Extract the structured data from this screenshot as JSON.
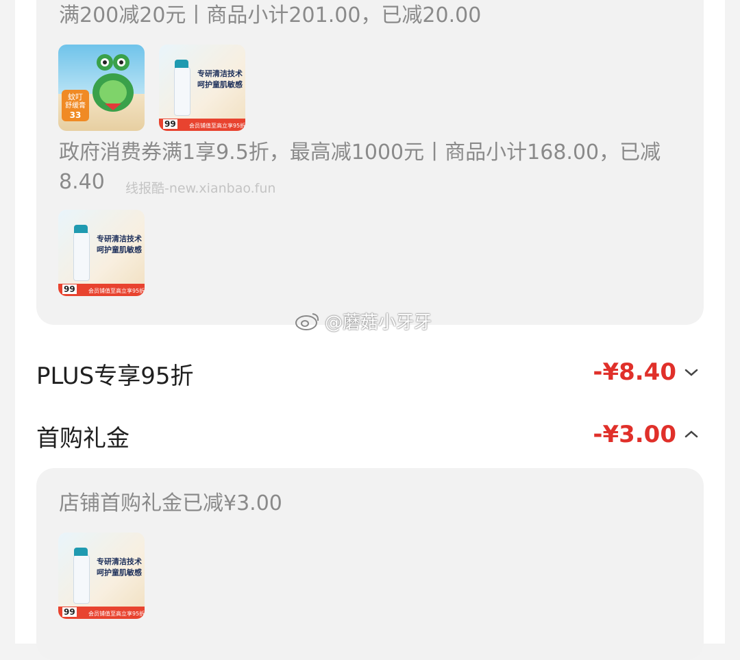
{
  "discount_groups": [
    {
      "description": "满200减20元丨商品小计201.00，已减20.00",
      "products": [
        {
          "image_desc": "frog-cream-product",
          "badge_line1": "蚊叮",
          "badge_line2": "舒缓膏",
          "price": "33"
        },
        {
          "image_desc": "aveeno-kids-wash",
          "headline_1": "专研清洁技术",
          "headline_2": "呵护童肌敏感",
          "price": "99",
          "banner": "会员铺值至高立享95折"
        }
      ]
    },
    {
      "description_line1": "政府消费券满1享9.5折，最高减1000元丨商品小计168.00，已减",
      "description_line2": "8.40",
      "products": [
        {
          "image_desc": "aveeno-kids-wash",
          "headline_1": "专研清洁技术",
          "headline_2": "呵护童肌敏感",
          "price": "99",
          "banner": "会员铺值至高立享95折"
        }
      ]
    }
  ],
  "watermark": "线报酷-new.xianbao.fun",
  "weibo_watermark": "@蘑菇小牙牙",
  "rows": [
    {
      "title": "PLUS专享95折",
      "amount": "-¥8.40",
      "chevron": "chevron-down-icon"
    },
    {
      "title": "首购礼金",
      "amount": "-¥3.00",
      "chevron": "chevron-up-icon"
    }
  ],
  "first_purchase": {
    "description": "店铺首购礼金已减¥3.00",
    "products": [
      {
        "image_desc": "aveeno-kids-wash",
        "headline_1": "专研清洁技术",
        "headline_2": "呵护童肌敏感",
        "price": "99",
        "banner": "会员铺值至高立享95折"
      }
    ]
  },
  "colors": {
    "accent": "#e0302a",
    "muted_text": "#8a8a8a",
    "card_bg": "#f2f2f2"
  }
}
